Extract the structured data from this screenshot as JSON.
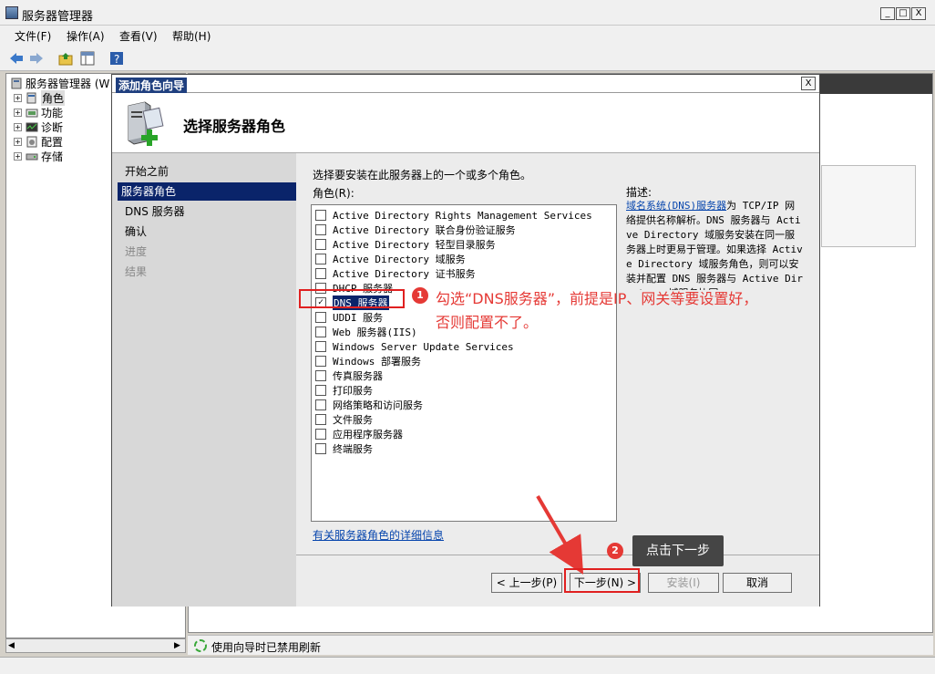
{
  "window": {
    "title": "服务器管理器",
    "controls": [
      "_",
      "□",
      "X"
    ]
  },
  "menu": [
    "文件(F)",
    "操作(A)",
    "查看(V)",
    "帮助(H)"
  ],
  "tree": {
    "root": "服务器管理器 (W",
    "items": [
      "角色",
      "功能",
      "诊断",
      "配置",
      "存储"
    ]
  },
  "status": {
    "text": "使用向导时已禁用刷新"
  },
  "dialog": {
    "title": "添加角色向导",
    "close": "X",
    "heading": "选择服务器角色",
    "nav": [
      "开始之前",
      "服务器角色",
      "DNS 服务器",
      "确认",
      "进度",
      "结果"
    ],
    "instruction": "选择要安装在此服务器上的一个或多个角色。",
    "roles_label": "角色(R):",
    "roles": [
      {
        "label": "Active Directory Rights Management Services",
        "checked": false
      },
      {
        "label": "Active Directory 联合身份验证服务",
        "checked": false
      },
      {
        "label": "Active Directory 轻型目录服务",
        "checked": false
      },
      {
        "label": "Active Directory 域服务",
        "checked": false
      },
      {
        "label": "Active Directory 证书服务",
        "checked": false
      },
      {
        "label": "DHCP 服务器",
        "checked": false
      },
      {
        "label": "DNS 服务器",
        "checked": true
      },
      {
        "label": "UDDI 服务",
        "checked": false
      },
      {
        "label": "Web 服务器(IIS)",
        "checked": false
      },
      {
        "label": "Windows Server Update Services",
        "checked": false
      },
      {
        "label": "Windows 部署服务",
        "checked": false
      },
      {
        "label": "传真服务器",
        "checked": false
      },
      {
        "label": "打印服务",
        "checked": false
      },
      {
        "label": "网络策略和访问服务",
        "checked": false
      },
      {
        "label": "文件服务",
        "checked": false
      },
      {
        "label": "应用程序服务器",
        "checked": false
      },
      {
        "label": "终端服务",
        "checked": false
      }
    ],
    "description_label": "描述:",
    "description_link": "域名系统(DNS)服务器",
    "description_text": "为 TCP/IP 网络提供名称解析。DNS 服务器与 Active Directory 域服务安装在同一服务器上时更易于管理。如果选择 Active Directory 域服务角色，则可以安装并配置 DNS 服务器与 Active Directory 域服务协同",
    "more_info_link": "有关服务器角色的详细信息",
    "buttons": {
      "prev": "< 上一步(P)",
      "next": "下一步(N) >",
      "install": "安装(I)",
      "cancel": "取消"
    }
  },
  "annotations": {
    "step1_num": "1",
    "step1_line1": "勾选“DNS服务器”，前提是IP、网关等要设置好，",
    "step1_line2": "否则配置不了。",
    "step2_num": "2",
    "step2_text": "点击下一步"
  },
  "colors": {
    "selection": "#0a246a",
    "annotation_red": "#e53935",
    "tooltip_bg": "#454545"
  }
}
